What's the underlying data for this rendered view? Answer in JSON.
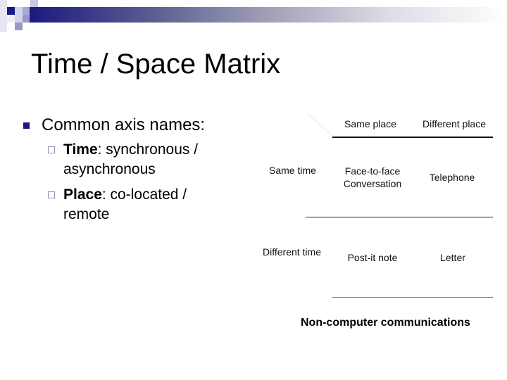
{
  "colors": {
    "accent_navy": "#1a1a80",
    "sub_bullet": "#9090b0",
    "text": "#000000"
  },
  "decoration": {
    "corner_squares_icon": "decorative-squares",
    "header_bar": "gradient-bar"
  },
  "slide": {
    "title": "Time / Space Matrix",
    "bullets": [
      {
        "icon": "filled-square",
        "text": "Common axis names:",
        "sub_bullets": [
          {
            "icon": "hollow-square",
            "label": "Time",
            "text_line1": ":  synchronous /",
            "text_line2": "asynchronous"
          },
          {
            "icon": "hollow-square",
            "label": "Place",
            "text_line1": ":  co-located /",
            "text_line2": "remote"
          }
        ]
      }
    ]
  },
  "matrix": {
    "column_headers": [
      "Same place",
      "Different place"
    ],
    "rows": [
      {
        "header": "Same time",
        "cells": [
          "Face-to-face\nConversation",
          "Telephone"
        ],
        "cell_lines": [
          [
            "Face-to-face",
            "Conversation"
          ],
          [
            "Telephone"
          ]
        ]
      },
      {
        "header": "Different time",
        "cells": [
          "Post-it note",
          "Letter"
        ],
        "cell_lines": [
          [
            "Post-it note"
          ],
          [
            "Letter"
          ]
        ]
      }
    ],
    "caption": "Non-computer communications"
  }
}
